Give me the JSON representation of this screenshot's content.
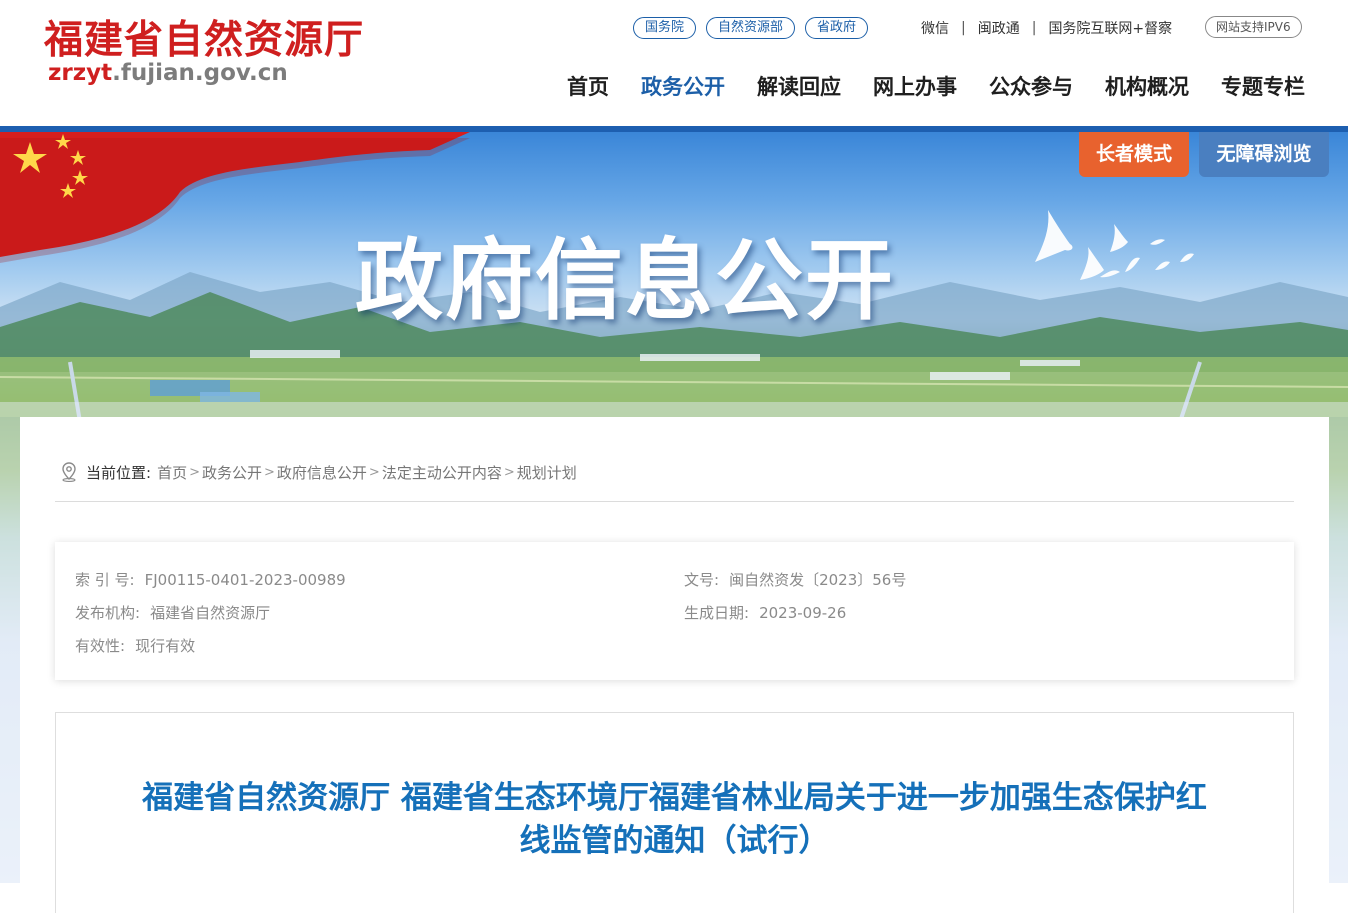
{
  "header": {
    "site_name": "福建省自然资源厅",
    "domain_prefix": "zrzyt",
    "domain_suffix": ".fujian.gov.cn",
    "pills": [
      "国务院",
      "自然资源部",
      "省政府"
    ],
    "text_links": [
      "微信",
      "闽政通",
      "国务院互联网+督察"
    ],
    "ipv6": "网站支持IPV6"
  },
  "nav": {
    "items": [
      "首页",
      "政务公开",
      "解读回应",
      "网上办事",
      "公众参与",
      "机构概况",
      "专题专栏"
    ],
    "active": "政务公开"
  },
  "banner": {
    "title": "政府信息公开",
    "elder_mode": "长者模式",
    "accessible": "无障碍浏览"
  },
  "breadcrumb": {
    "label": "当前位置:",
    "items": [
      "首页",
      "政务公开",
      "政府信息公开",
      "法定主动公开内容",
      "规划计划"
    ]
  },
  "meta": {
    "index_label": "索 引 号:",
    "index_value": "FJ00115-0401-2023-00989",
    "doc_no_label": "文号:",
    "doc_no_value": "闽自然资发〔2023〕56号",
    "publisher_label": "发布机构:",
    "publisher_value": "福建省自然资源厅",
    "date_label": "生成日期:",
    "date_value": "2023-09-26",
    "validity_label": "有效性:",
    "validity_value": "现行有效"
  },
  "document": {
    "title_line1": "福建省自然资源厅 福建省生态环境厅福建省林业局关于进一步加强生态保护红",
    "title_line2": "线监管的通知（试行）"
  },
  "colors": {
    "brand_red": "#cf1f1f",
    "brand_blue": "#1c5fa8",
    "elder_orange": "#e8622e",
    "accessible_blue": "#4a7fc0",
    "title_blue": "#1570b9"
  }
}
